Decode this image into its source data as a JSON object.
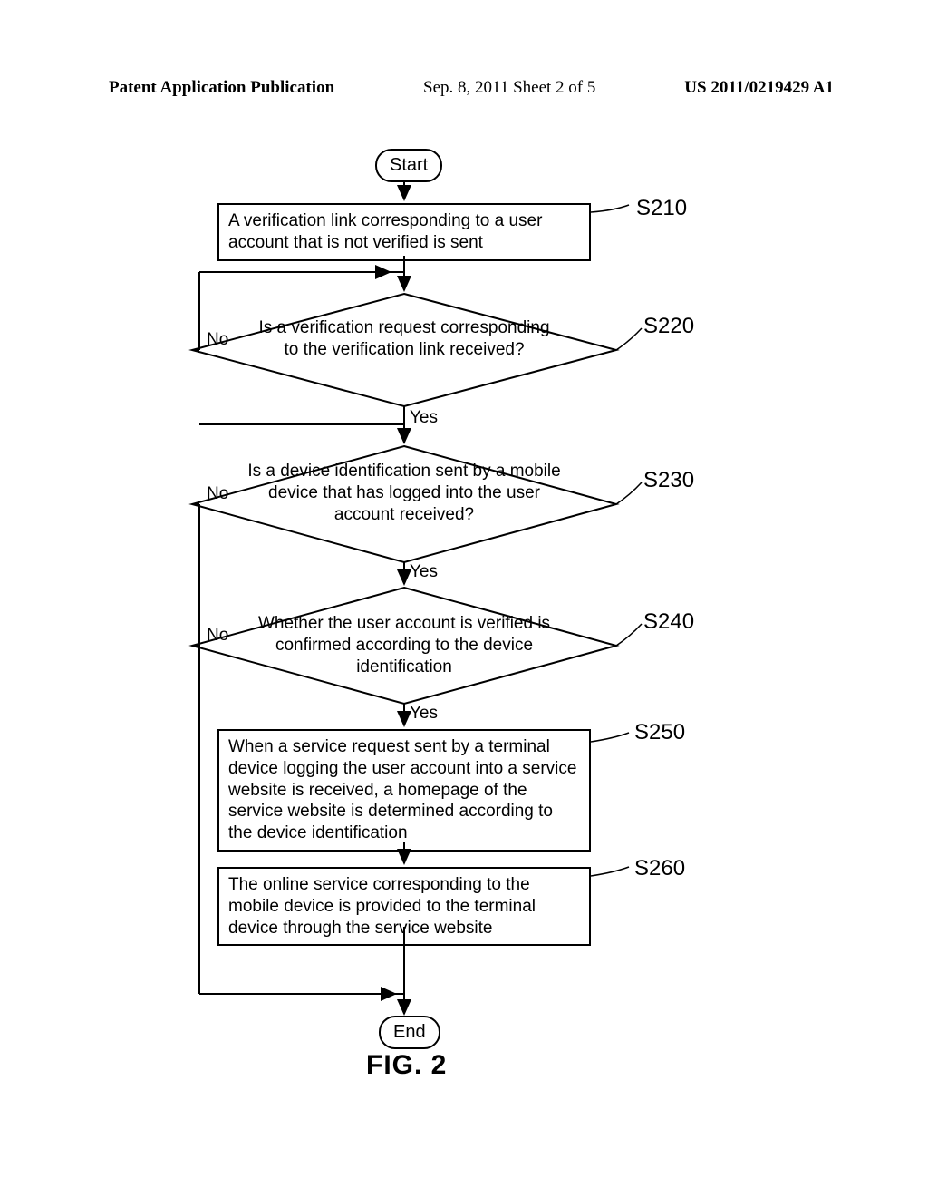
{
  "header": {
    "left": "Patent Application Publication",
    "center": "Sep. 8, 2011  Sheet 2 of 5",
    "right": "US 2011/0219429 A1"
  },
  "chart_data": {
    "type": "flowchart",
    "title": "FIG. 2",
    "nodes": [
      {
        "id": "start",
        "type": "terminal",
        "label": "Start"
      },
      {
        "id": "S210",
        "type": "process",
        "step": "S210",
        "label": "A verification link corresponding to a user account that is not verified is sent"
      },
      {
        "id": "S220",
        "type": "decision",
        "step": "S220",
        "label": "Is a verification request corresponding to the verification link received?",
        "yes": "S230",
        "no": "loop_S220"
      },
      {
        "id": "S230",
        "type": "decision",
        "step": "S230",
        "label": "Is a device identification sent by a mobile device that has logged into the user account received?",
        "yes": "S240",
        "no": "end"
      },
      {
        "id": "S240",
        "type": "decision",
        "step": "S240",
        "label": "Whether the user account is verified is confirmed according to the device identification",
        "yes": "S250",
        "no": "end"
      },
      {
        "id": "S250",
        "type": "process",
        "step": "S250",
        "label": "When a service request sent by a terminal device logging the user account into a service website is received, a homepage of the service website is determined according to the device identification"
      },
      {
        "id": "S260",
        "type": "process",
        "step": "S260",
        "label": "The online service corresponding to the mobile device is provided to the terminal device through the service website"
      },
      {
        "id": "end",
        "type": "terminal",
        "label": "End"
      }
    ],
    "branch_labels": {
      "yes": "Yes",
      "no": "No"
    }
  }
}
